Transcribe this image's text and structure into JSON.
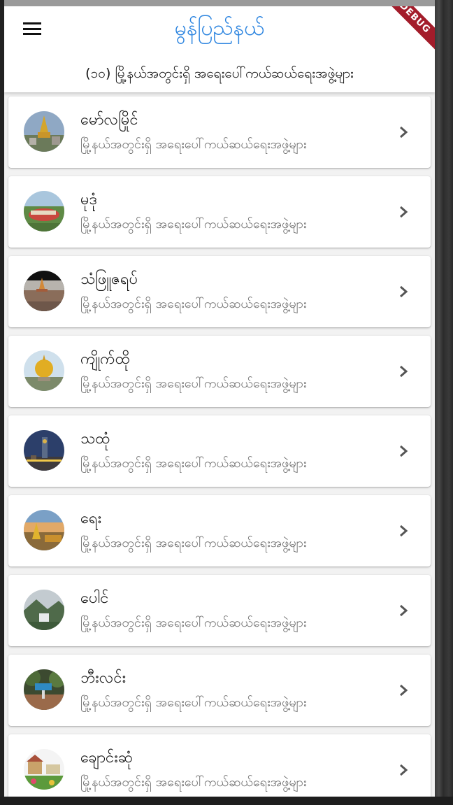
{
  "app_bar": {
    "title": "မွန်ပြည်နယ်",
    "subtitle": "(၁၀) မြို့နယ်အတွင်းရှိ အရေးပေါ်ကယ်ဆယ်ရေးအဖွဲ့များ",
    "debug_banner": "DEBUG"
  },
  "colors": {
    "title": "#2f86e0",
    "card_background": "#ffffff",
    "list_background": "#f2f2f2",
    "debug_banner": "#a31c2a"
  },
  "towns": [
    {
      "name": "မော်လမြိုင်",
      "subtitle": "မြို့နယ်အတွင်းရှိ အရေးပေါ်ကယ်ဆယ်ရေးအဖွဲ့များ",
      "thumb": "pagoda-hill-photo"
    },
    {
      "name": "မုဒုံ",
      "subtitle": "မြို့နယ်အတွင်းရှိ အရေးပေါ်ကယ်ဆယ်ရေးအဖွဲ့များ",
      "thumb": "reclining-buddha-photo"
    },
    {
      "name": "သံဖြူဇရပ်",
      "subtitle": "မြို့နယ်အတွင်းရှိ အရေးပေါ်ကယ်ဆယ်ရေးအဖွဲ့များ",
      "thumb": "river-pagoda-photo"
    },
    {
      "name": "ကျိုက်ထို",
      "subtitle": "မြို့နယ်အတွင်းရှိ အရေးပေါ်ကယ်ဆယ်ရေးအဖွဲ့များ",
      "thumb": "golden-rock-photo"
    },
    {
      "name": "သထုံ",
      "subtitle": "မြို့နယ်အတွင်းရှိ အရေးပေါ်ကယ်ဆယ်ရေးအဖွဲ့များ",
      "thumb": "clock-tower-photo"
    },
    {
      "name": "ရေး",
      "subtitle": "မြို့နယ်အတွင်းရှိ အရေးပေါ်ကယ်ဆယ်ရေးအဖွဲ့များ",
      "thumb": "sunset-pagoda-photo"
    },
    {
      "name": "ပေါင်",
      "subtitle": "မြို့နယ်အတွင်းရှိ အရေးပေါ်ကယ်ဆယ်ရေးအဖွဲ့များ",
      "thumb": "mountain-mist-photo"
    },
    {
      "name": "ဘီးလင်း",
      "subtitle": "မြို့နယ်အတွင်းရှိ အရေးပေါ်ကယ်ဆယ်ရေးအဖွဲ့များ",
      "thumb": "town-sign-photo"
    },
    {
      "name": "ချောင်းဆုံ",
      "subtitle": "မြို့နယ်အတွင်းရှိ အရေးပေါ်ကယ်ဆယ်ရေးအဖွဲ့များ",
      "thumb": "village-flowers-photo"
    }
  ]
}
